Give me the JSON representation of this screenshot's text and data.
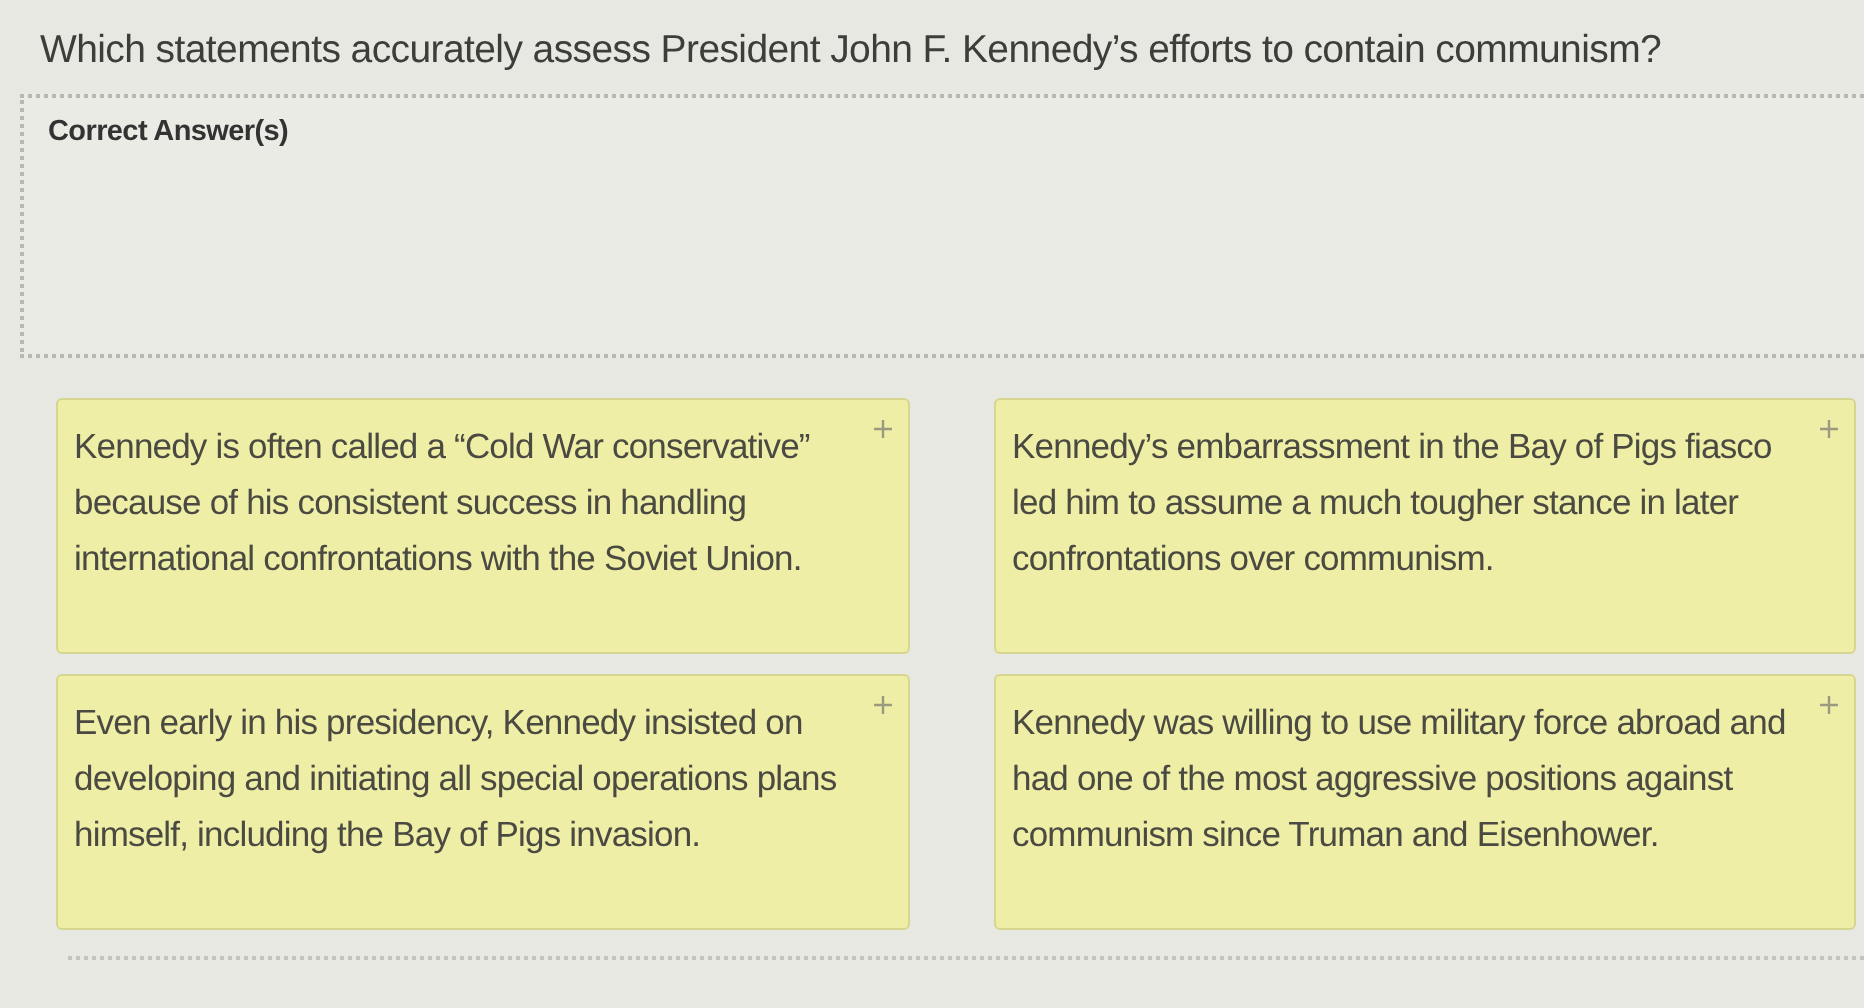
{
  "question": "Which statements accurately assess President John F. Kennedy’s efforts to contain communism?",
  "answer_zone": {
    "label": "Correct Answer(s)"
  },
  "options": [
    {
      "text": "Kennedy is often called a “Cold War conservative” because of his consistent success in handling international confrontations with the Soviet Union."
    },
    {
      "text": "Kennedy’s embarrassment in the Bay of Pigs fiasco led him to assume a much tougher stance in later confrontations over communism."
    },
    {
      "text": "Even early in his presidency, Kennedy insisted on developing and initiating all special operations plans himself, including the Bay of Pigs invasion."
    },
    {
      "text": "Kennedy was willing to use military force abroad and had one of the most aggressive positions against communism since Truman and Eisenhower."
    }
  ]
}
